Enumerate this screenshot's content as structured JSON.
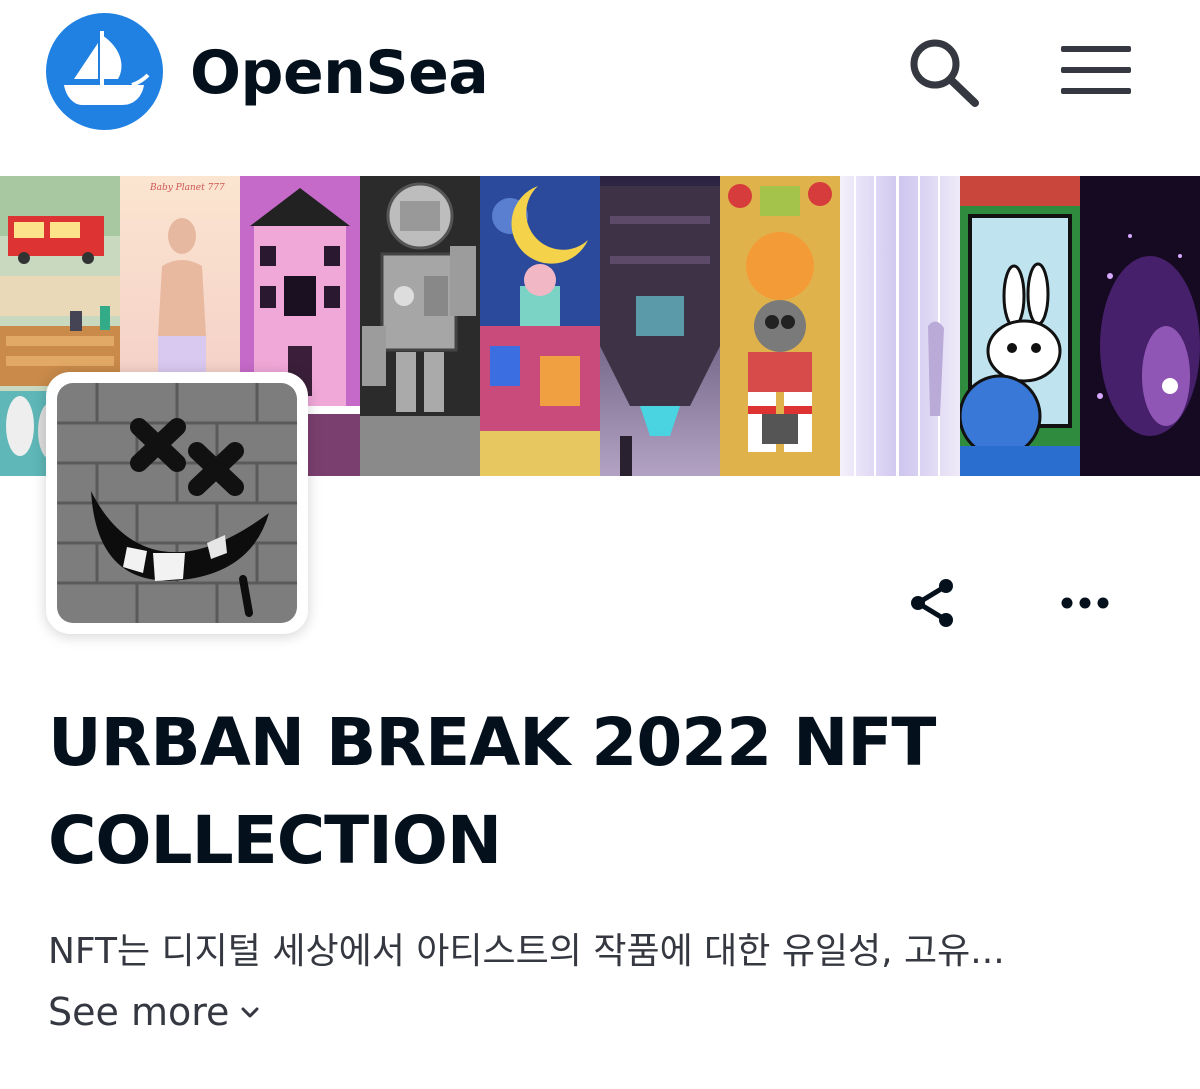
{
  "header": {
    "brand": "OpenSea",
    "logo_icon": "opensea-ship-icon",
    "search_icon": "search-icon",
    "menu_icon": "hamburger-menu-icon",
    "accent": "#2081e2"
  },
  "banner": {
    "tiles": [
      {
        "name": "banner-tile-pixel-foodtruck"
      },
      {
        "name": "banner-tile-baby-planet",
        "caption": "Baby Planet 777"
      },
      {
        "name": "banner-tile-pink-house"
      },
      {
        "name": "banner-tile-robot"
      },
      {
        "name": "banner-tile-moon-night"
      },
      {
        "name": "banner-tile-spaceship"
      },
      {
        "name": "banner-tile-gasmask-character"
      },
      {
        "name": "banner-tile-light-rain"
      },
      {
        "name": "banner-tile-bunny-cartoon"
      },
      {
        "name": "banner-tile-purple-particles"
      }
    ]
  },
  "collection": {
    "title": "URBAN BREAK 2022 NFT COLLECTION",
    "description": "NFT는 디지털 세상에서 아티스트의 작품에 대한 유일성, 고유...",
    "see_more": "See more",
    "share_icon": "share-icon",
    "more_icon": "more-options-icon"
  }
}
